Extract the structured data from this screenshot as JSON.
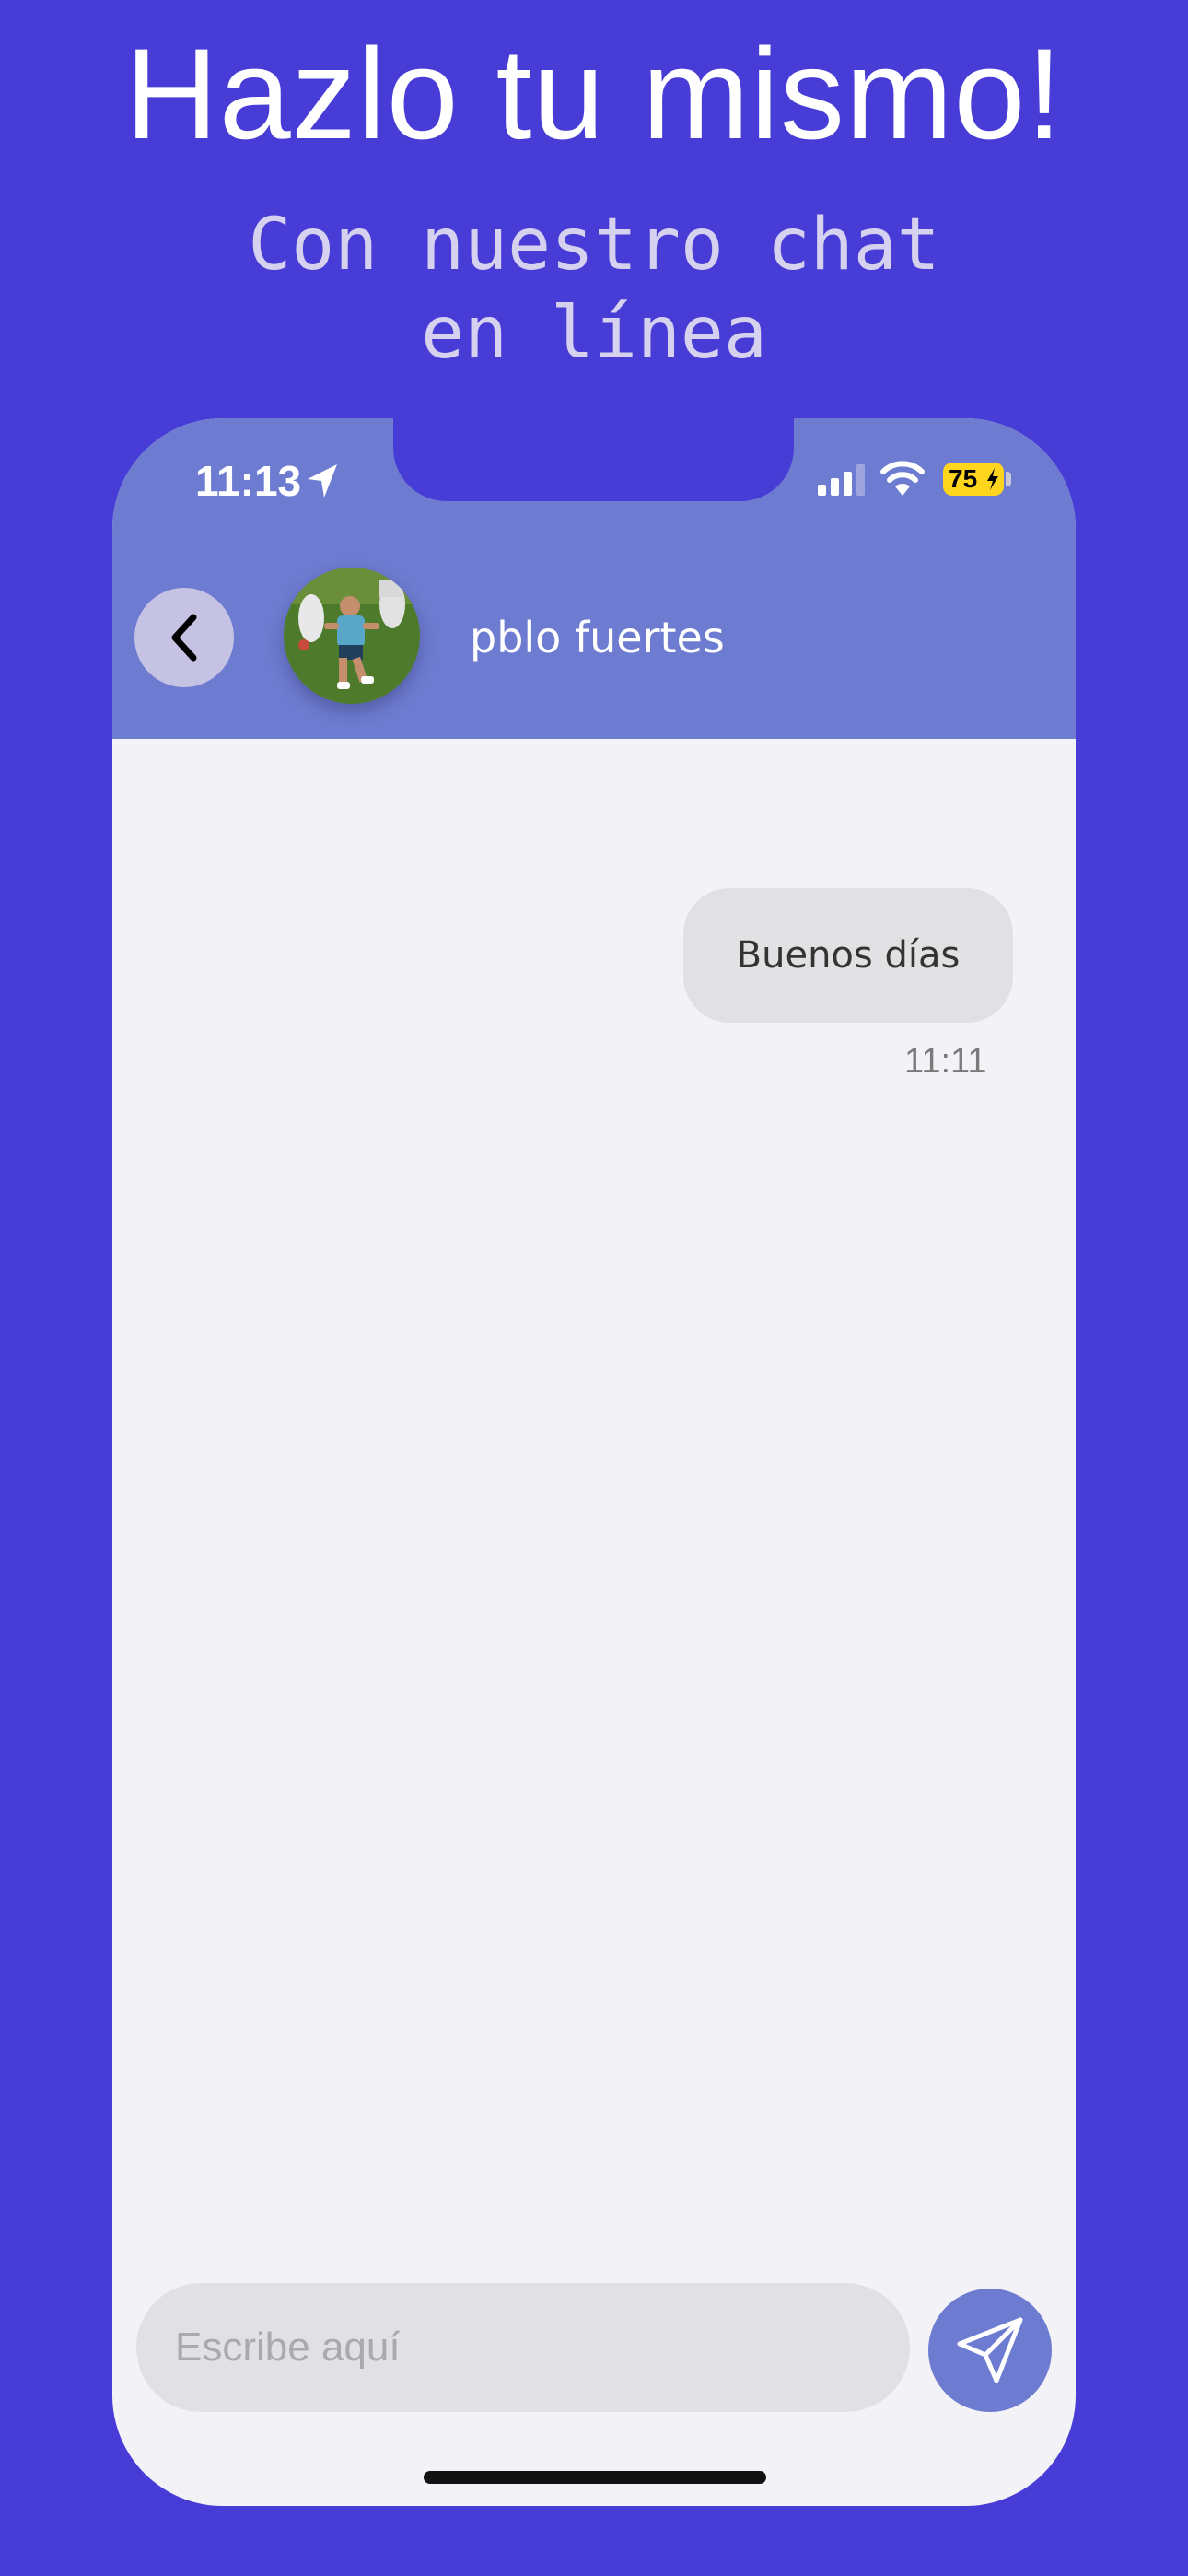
{
  "promo": {
    "headline": "Hazlo tu mismo!",
    "subheadline_line1": "Con nuestro chat",
    "subheadline_line2": "en línea"
  },
  "status_bar": {
    "time": "11:13",
    "battery_percent": "75",
    "icons": [
      "location-arrow-icon",
      "cellular-signal-icon",
      "wifi-icon",
      "battery-charging-icon"
    ]
  },
  "chat_header": {
    "contact_name": "pblo fuertes",
    "back_icon": "chevron-left-icon",
    "avatar": "contact-avatar-photo"
  },
  "messages": [
    {
      "text": "Buenos días",
      "time": "11:11",
      "direction": "outgoing"
    }
  ],
  "composer": {
    "placeholder": "Escribe aquí",
    "value": "",
    "send_icon": "paper-plane-icon"
  },
  "colors": {
    "background": "#473DD6",
    "header": "#6D7BD0",
    "chat_background": "#F3F2F7",
    "bubble": "#E1E1E3",
    "send_button": "#6D7BD0",
    "battery": "#FFD51E"
  }
}
